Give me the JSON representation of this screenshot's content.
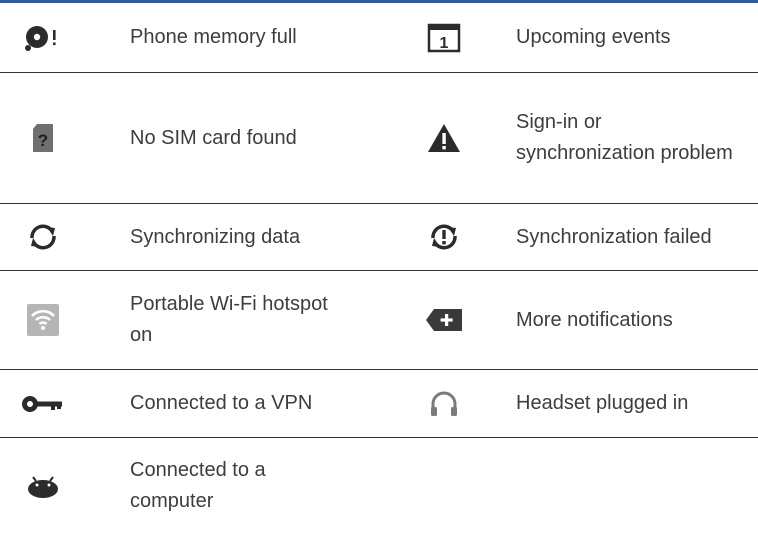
{
  "rows": [
    {
      "left_icon": "memory-full-icon",
      "left_label": "Phone memory full",
      "right_icon": "calendar-event-icon",
      "right_label": "Upcoming events",
      "calendar_day": "1"
    },
    {
      "left_icon": "no-sim-icon",
      "left_label": "No SIM card found",
      "right_icon": "warning-icon",
      "right_label": "Sign-in or synchronization problem"
    },
    {
      "left_icon": "sync-icon",
      "left_label": "Synchronizing data",
      "right_icon": "sync-failed-icon",
      "right_label": "Synchronization failed"
    },
    {
      "left_icon": "wifi-hotspot-icon",
      "left_label": "Portable Wi-Fi hotspot on",
      "right_icon": "more-notifications-icon",
      "right_label": "More notifications"
    },
    {
      "left_icon": "vpn-key-icon",
      "left_label": "Connected to a VPN",
      "right_icon": "headset-icon",
      "right_label": "Headset plugged in"
    },
    {
      "left_icon": "usb-android-icon",
      "left_label": "Connected to a computer"
    }
  ],
  "colors": {
    "header_rule": "#2e5d99",
    "row_rule": "#333333",
    "text": "#3d3d3d",
    "icon_dark": "#2b2b2b",
    "icon_grey": "#6f6f6f"
  }
}
